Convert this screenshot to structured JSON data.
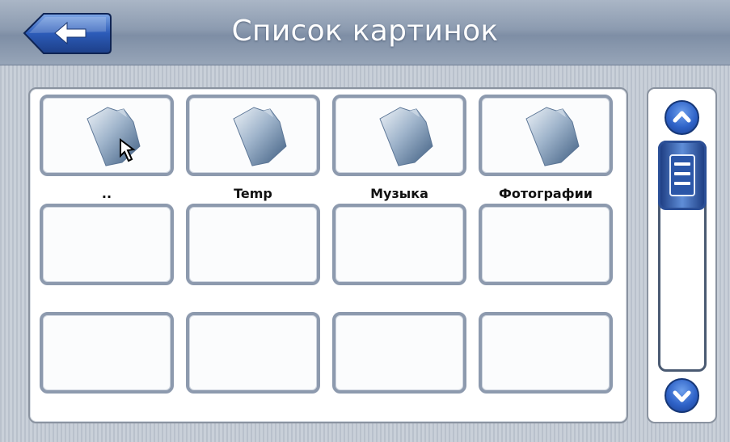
{
  "header": {
    "title": "Список картинок",
    "back_icon": "arrow-left-icon"
  },
  "grid": {
    "items": [
      {
        "label": "..",
        "icon": "folder-icon",
        "has_cursor": true
      },
      {
        "label": "Temp",
        "icon": "folder-icon"
      },
      {
        "label": "Музыка",
        "icon": "folder-icon"
      },
      {
        "label": "Фотографии",
        "icon": "folder-icon"
      },
      {
        "label": ""
      },
      {
        "label": ""
      },
      {
        "label": ""
      },
      {
        "label": ""
      },
      {
        "label": ""
      },
      {
        "label": ""
      },
      {
        "label": ""
      },
      {
        "label": ""
      }
    ]
  },
  "scroll": {
    "up_icon": "chevron-up-icon",
    "down_icon": "chevron-down-icon",
    "thumb_icon": "scroll-thumb-grip-icon"
  },
  "colors": {
    "header_top": "#aab6c6",
    "accent_blue": "#2f63c8",
    "tile_border": "#8d9aae"
  }
}
